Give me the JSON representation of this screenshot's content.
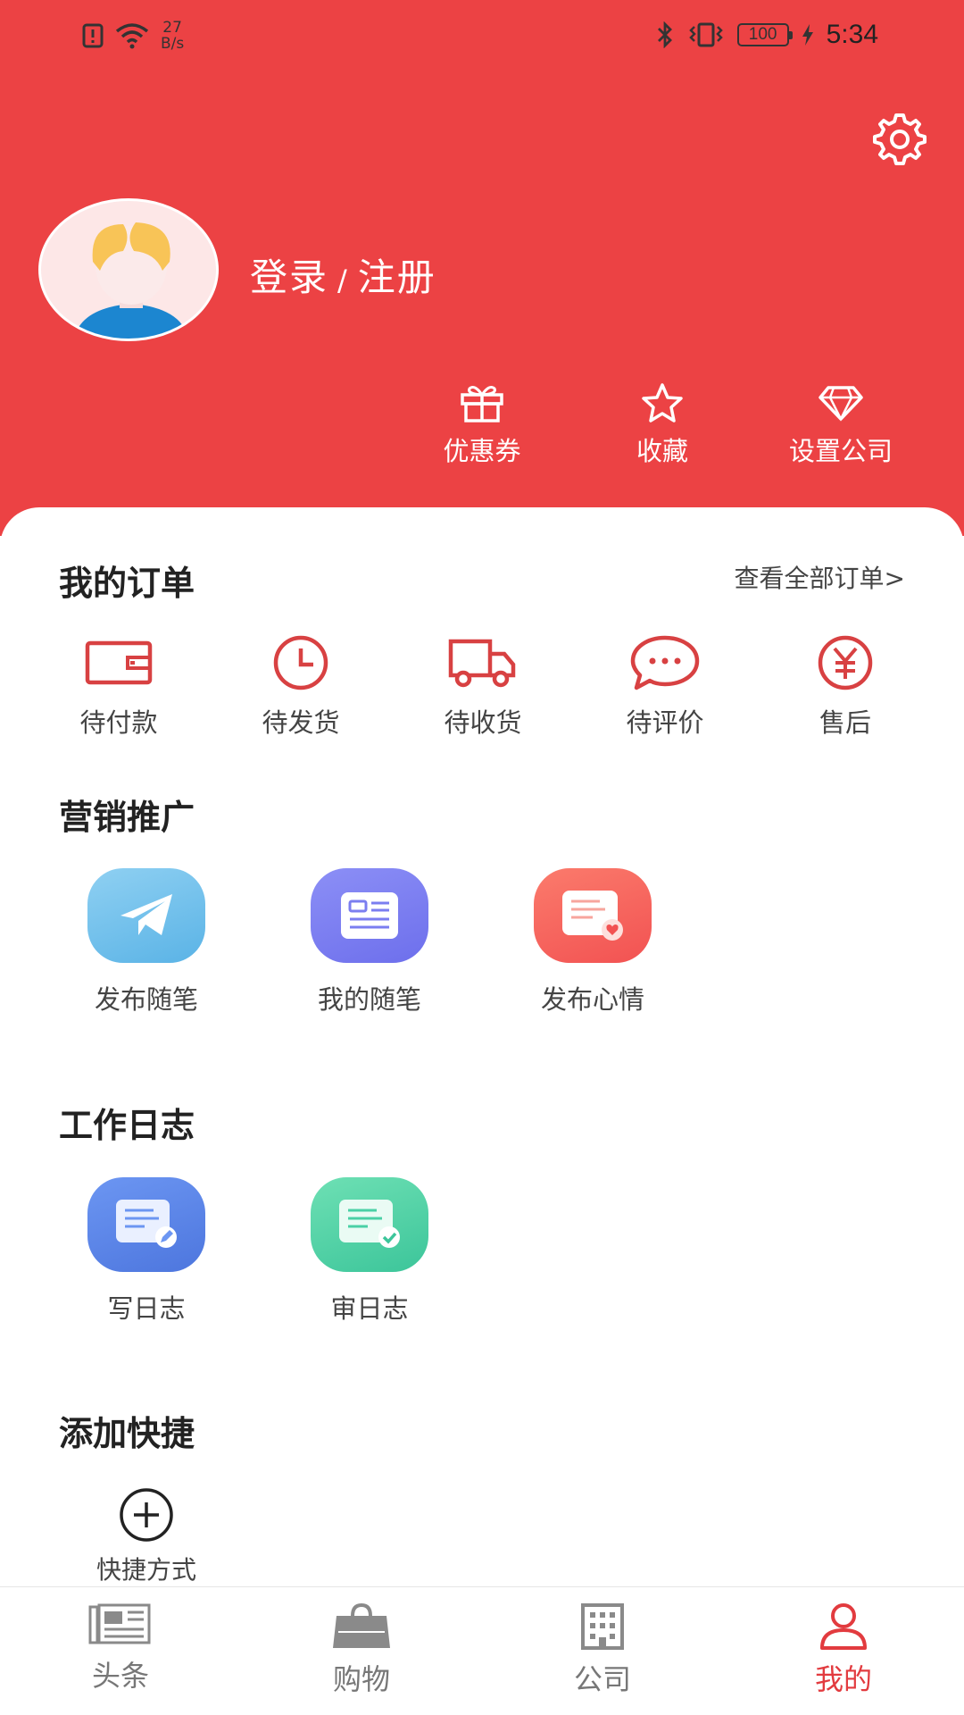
{
  "status_bar": {
    "speed_value": "27",
    "speed_unit": "B/s",
    "battery": "100",
    "time": "5:34"
  },
  "profile": {
    "login": "登录",
    "separator": "/",
    "register": "注册"
  },
  "header_actions": [
    {
      "label": "优惠券",
      "icon": "gift-icon"
    },
    {
      "label": "收藏",
      "icon": "star-icon"
    },
    {
      "label": "设置公司",
      "icon": "diamond-icon"
    }
  ],
  "orders": {
    "title": "我的订单",
    "view_all": "查看全部订单>",
    "items": [
      {
        "label": "待付款",
        "icon": "wallet-icon"
      },
      {
        "label": "待发货",
        "icon": "clock-icon"
      },
      {
        "label": "待收货",
        "icon": "truck-icon"
      },
      {
        "label": "待评价",
        "icon": "chat-icon"
      },
      {
        "label": "售后",
        "icon": "yen-icon"
      }
    ]
  },
  "marketing": {
    "title": "营销推广",
    "items": [
      {
        "label": "发布随笔",
        "icon": "paper-plane-icon",
        "color": "#6ec1ea"
      },
      {
        "label": "我的随笔",
        "icon": "news-card-icon",
        "color": "#7a7df1"
      },
      {
        "label": "发布心情",
        "icon": "heart-note-icon",
        "color": "#f7665e"
      }
    ]
  },
  "worklog": {
    "title": "工作日志",
    "items": [
      {
        "label": "写日志",
        "icon": "write-log-icon",
        "color": "#5b86ea"
      },
      {
        "label": "审日志",
        "icon": "review-log-icon",
        "color": "#4bd0a6"
      }
    ]
  },
  "shortcuts": {
    "title": "添加快捷",
    "add_label": "快捷方式"
  },
  "tabbar": {
    "items": [
      {
        "label": "头条",
        "icon": "newspaper-icon"
      },
      {
        "label": "购物",
        "icon": "shopping-bag-icon"
      },
      {
        "label": "公司",
        "icon": "building-icon"
      },
      {
        "label": "我的",
        "icon": "user-icon",
        "active": true
      }
    ]
  },
  "colors": {
    "brand_red": "#ec4244",
    "active_tab": "#e23b3f"
  }
}
